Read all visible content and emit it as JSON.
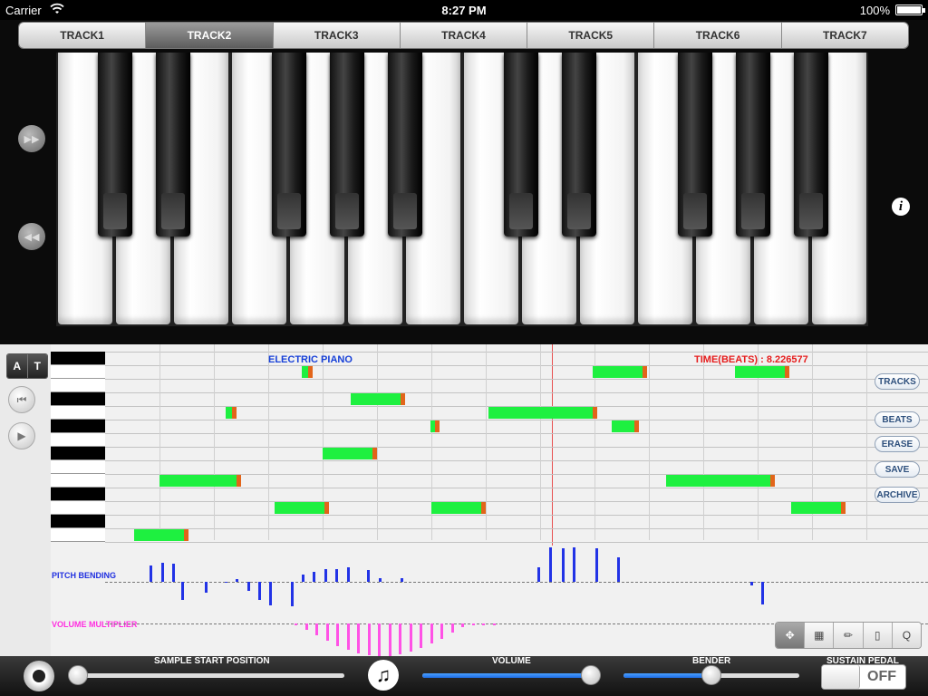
{
  "status_bar": {
    "carrier": "Carrier",
    "time": "8:27 PM",
    "battery": "100%"
  },
  "tracks": {
    "selected": "TRACK2",
    "items": [
      "TRACK1",
      "TRACK2",
      "TRACK3",
      "TRACK4",
      "TRACK5",
      "TRACK6",
      "TRACK7"
    ]
  },
  "keyboard": {
    "white_keys": 14
  },
  "sequencer": {
    "instrument": "ELECTRIC PIANO",
    "time_label": "TIME(BEATS) : 8.226577",
    "mode_buttons": [
      "A",
      "T"
    ],
    "actions": [
      "TRACKS",
      "BEATS",
      "ERASE",
      "SAVE",
      "ARCHIVE"
    ],
    "pitch_label": "PITCH BENDING",
    "volume_label": "VOLUME MULTIPLIER",
    "tools": [
      "move-tool",
      "select-tool",
      "pencil-tool",
      "eraser-tool",
      "quantize-tool"
    ],
    "quantize_label": "Q"
  },
  "bottom": {
    "sample_start_label": "SAMPLE START POSITION",
    "sample_start_value": 0.0,
    "volume_label": "VOLUME",
    "volume_value": 1.0,
    "bender_label": "BENDER",
    "bender_value": 0.5,
    "sustain_label": "SUSTAIN PEDAL",
    "sustain_state": "OFF"
  },
  "colors": {
    "note": "#1ef040",
    "note_end": "#e2651a",
    "pitch": "#2233e6",
    "volume": "#ff52e6",
    "playhead": "#e85050"
  }
}
